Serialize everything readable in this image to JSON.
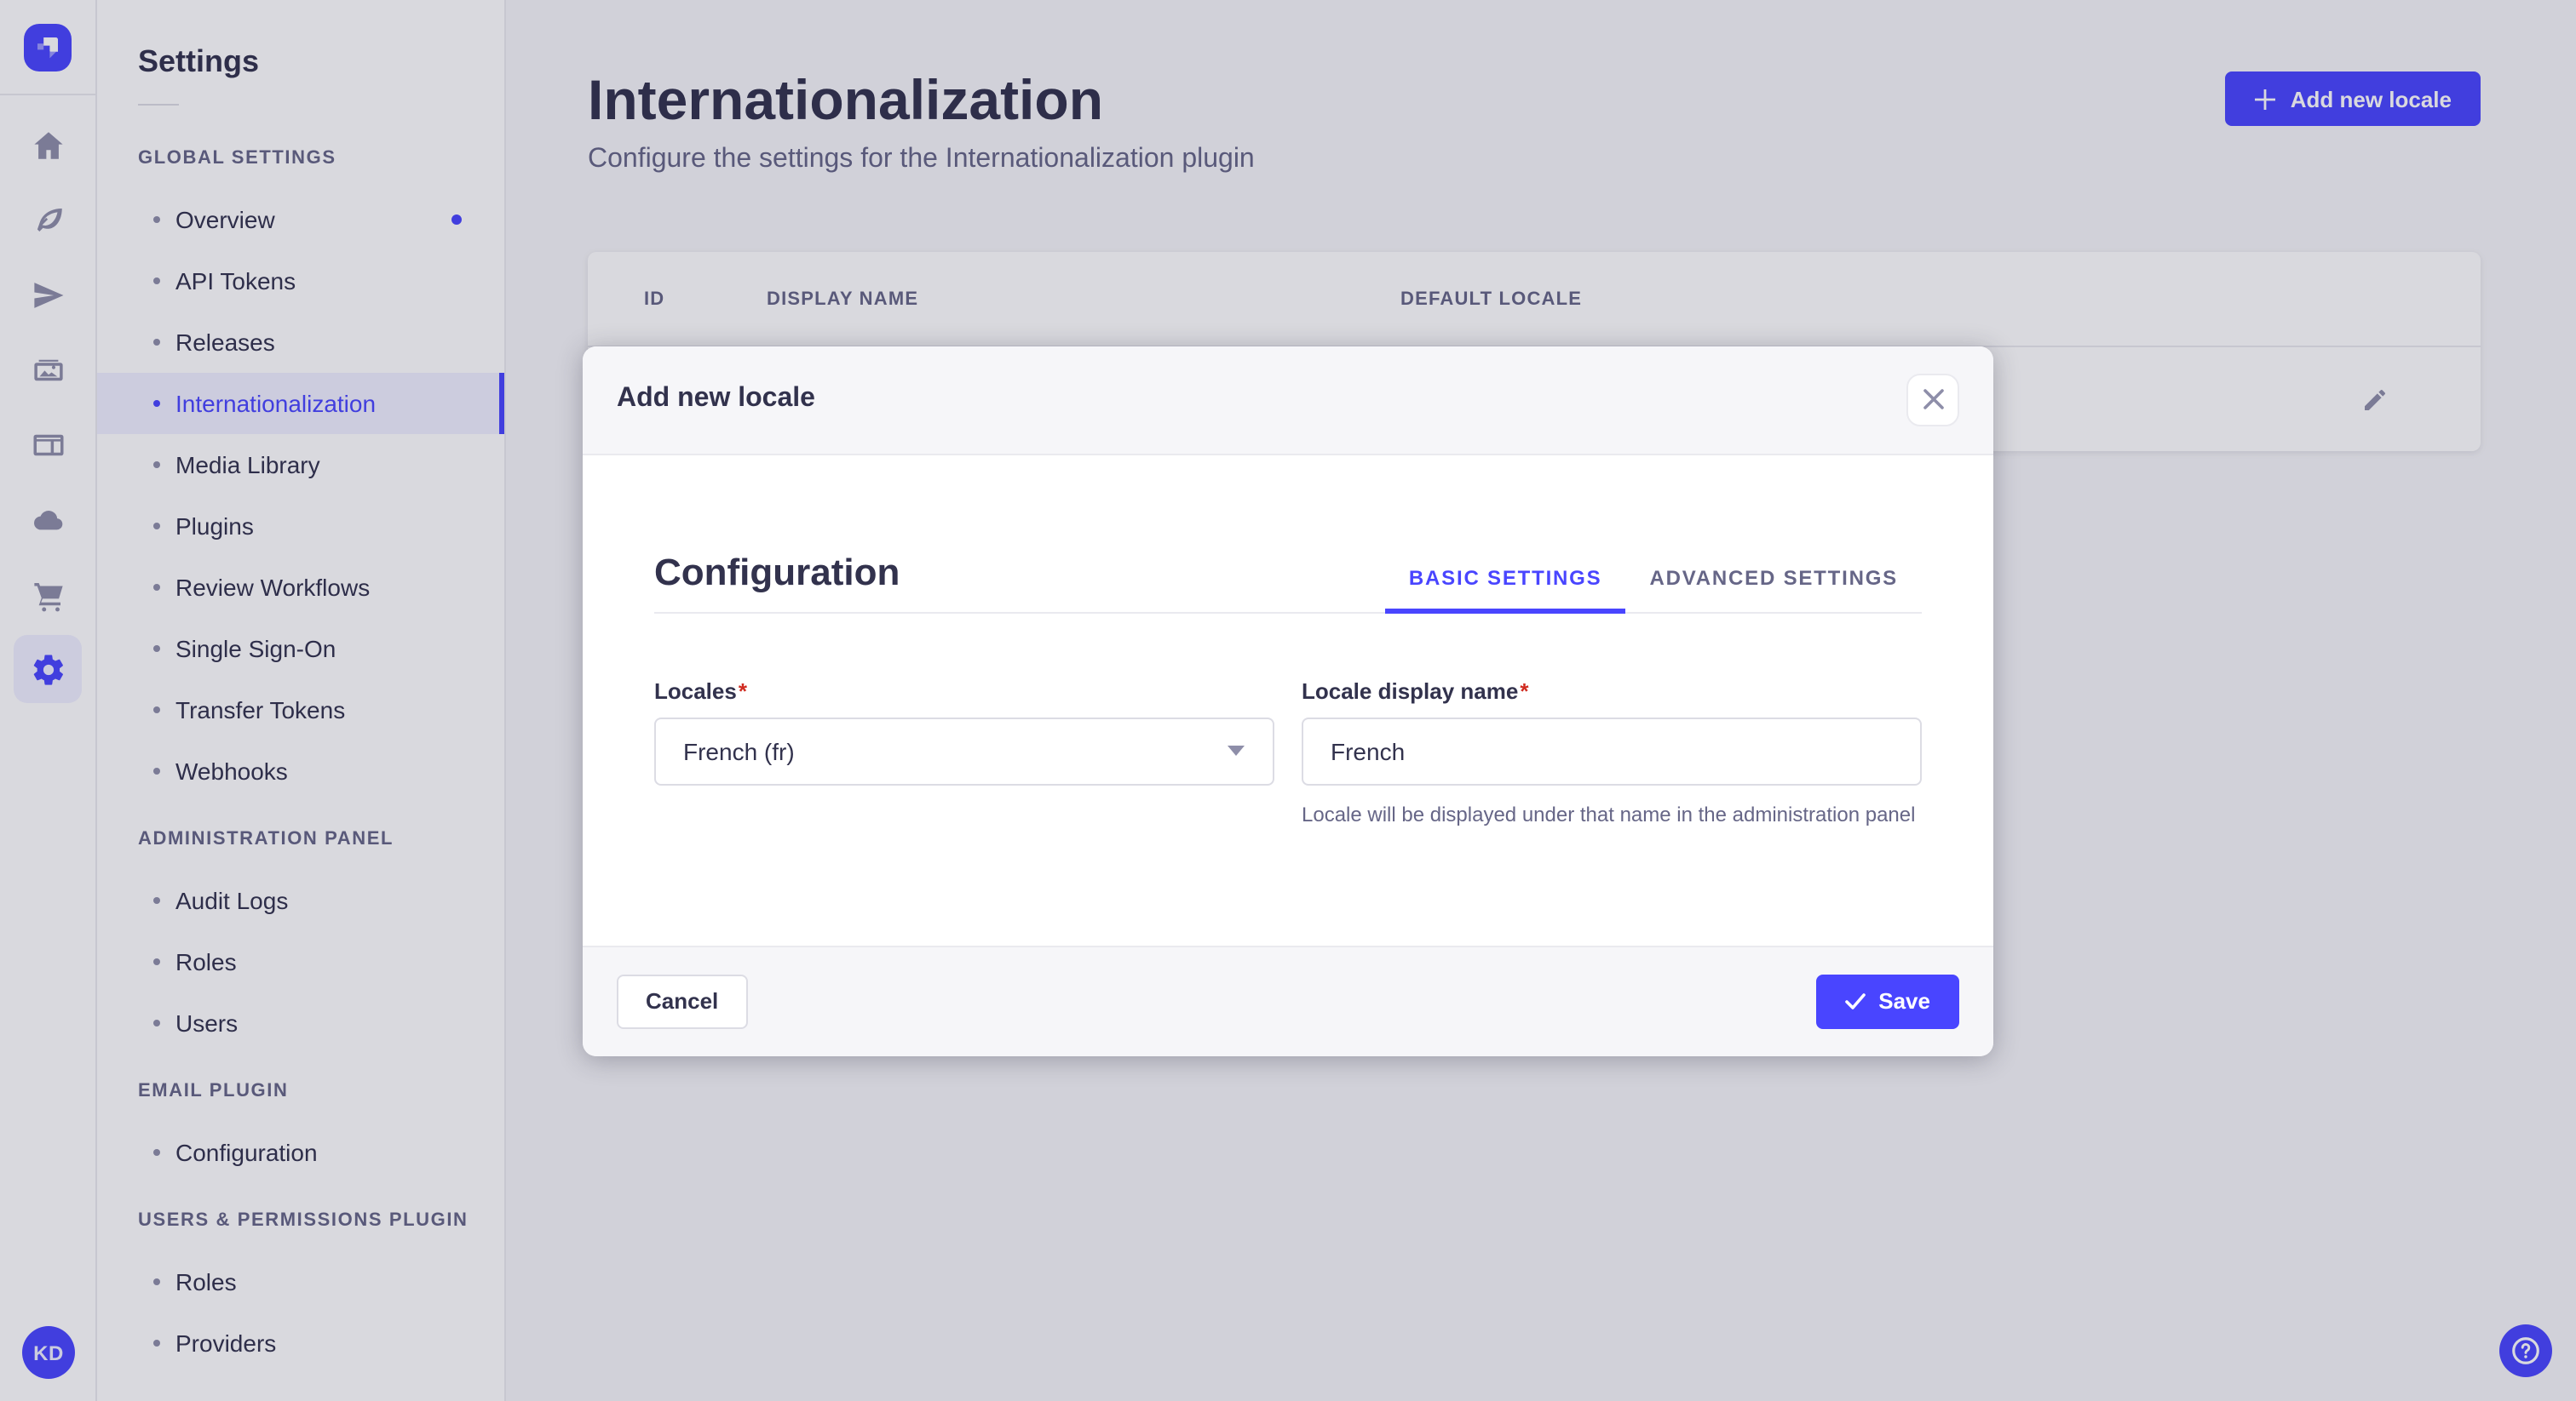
{
  "rail": {
    "icons": [
      "home",
      "content-type-builder",
      "deploy",
      "media-library",
      "content-manager",
      "cloud",
      "marketplace",
      "settings"
    ],
    "active_icon": "settings",
    "avatar_initials": "KD"
  },
  "nav": {
    "title": "Settings",
    "sections": [
      {
        "heading": "GLOBAL SETTINGS",
        "items": [
          {
            "label": "Overview",
            "notification": true
          },
          {
            "label": "API Tokens"
          },
          {
            "label": "Releases"
          },
          {
            "label": "Internationalization",
            "active": true
          },
          {
            "label": "Media Library"
          },
          {
            "label": "Plugins"
          },
          {
            "label": "Review Workflows"
          },
          {
            "label": "Single Sign-On"
          },
          {
            "label": "Transfer Tokens"
          },
          {
            "label": "Webhooks"
          }
        ]
      },
      {
        "heading": "ADMINISTRATION PANEL",
        "items": [
          {
            "label": "Audit Logs"
          },
          {
            "label": "Roles"
          },
          {
            "label": "Users"
          }
        ]
      },
      {
        "heading": "EMAIL PLUGIN",
        "items": [
          {
            "label": "Configuration"
          }
        ]
      },
      {
        "heading": "USERS & PERMISSIONS PLUGIN",
        "items": [
          {
            "label": "Roles"
          },
          {
            "label": "Providers"
          }
        ]
      }
    ]
  },
  "header": {
    "title": "Internationalization",
    "subtitle": "Configure the settings for the Internationalization plugin",
    "add_button_label": "Add new locale"
  },
  "table": {
    "columns": [
      "ID",
      "DISPLAY NAME",
      "DEFAULT LOCALE"
    ]
  },
  "modal": {
    "title": "Add new locale",
    "section_title": "Configuration",
    "tabs": [
      {
        "label": "BASIC SETTINGS",
        "active": true
      },
      {
        "label": "ADVANCED SETTINGS",
        "active": false
      }
    ],
    "required_marker": "*",
    "fields": {
      "locales": {
        "label": "Locales",
        "value": "French (fr)"
      },
      "display_name": {
        "label": "Locale display name",
        "value": "French",
        "hint": "Locale will be displayed under that name in the administration panel"
      }
    },
    "cancel_label": "Cancel",
    "save_label": "Save"
  },
  "colors": {
    "primary": "#4945ff",
    "primary_light": "#f0f0ff",
    "text": "#32324d",
    "muted": "#666687",
    "border": "#dcdce4",
    "divider": "#eaeaef",
    "danger": "#d02b20"
  }
}
